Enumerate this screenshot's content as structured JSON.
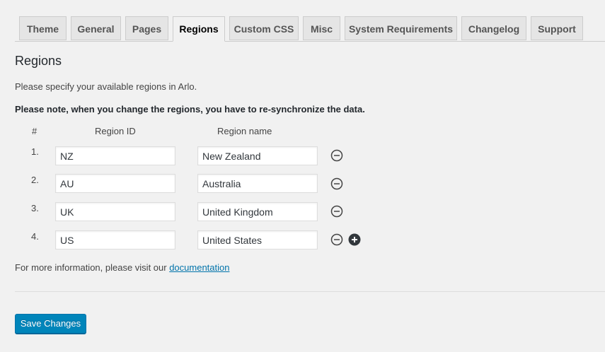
{
  "tabs": [
    {
      "label": "Theme",
      "active": false
    },
    {
      "label": "General",
      "active": false
    },
    {
      "label": "Pages",
      "active": false
    },
    {
      "label": "Regions",
      "active": true
    },
    {
      "label": "Custom CSS",
      "active": false
    },
    {
      "label": "Misc",
      "active": false
    },
    {
      "label": "System Requirements",
      "active": false
    },
    {
      "label": "Changelog",
      "active": false
    },
    {
      "label": "Support",
      "active": false
    }
  ],
  "section": {
    "title": "Regions",
    "description": "Please specify your available regions in Arlo.",
    "note": "Please note, when you change the regions, you have to re-synchronize the data."
  },
  "table": {
    "headers": {
      "num": "#",
      "region_id": "Region ID",
      "region_name": "Region name"
    },
    "rows": [
      {
        "num": "1.",
        "id": "NZ",
        "name": "New Zealand"
      },
      {
        "num": "2.",
        "id": "AU",
        "name": "Australia"
      },
      {
        "num": "3.",
        "id": "UK",
        "name": "United Kingdom"
      },
      {
        "num": "4.",
        "id": "US",
        "name": "United States"
      }
    ],
    "remove_icon": "minus-circle-icon",
    "add_icon": "plus-circle-icon"
  },
  "footer": {
    "more_info_prefix": "For more information, please visit our ",
    "more_info_link": "documentation"
  },
  "save_label": "Save Changes",
  "colors": {
    "accent": "#0085ba",
    "link": "#0073aa",
    "background": "#f1f1f1"
  }
}
